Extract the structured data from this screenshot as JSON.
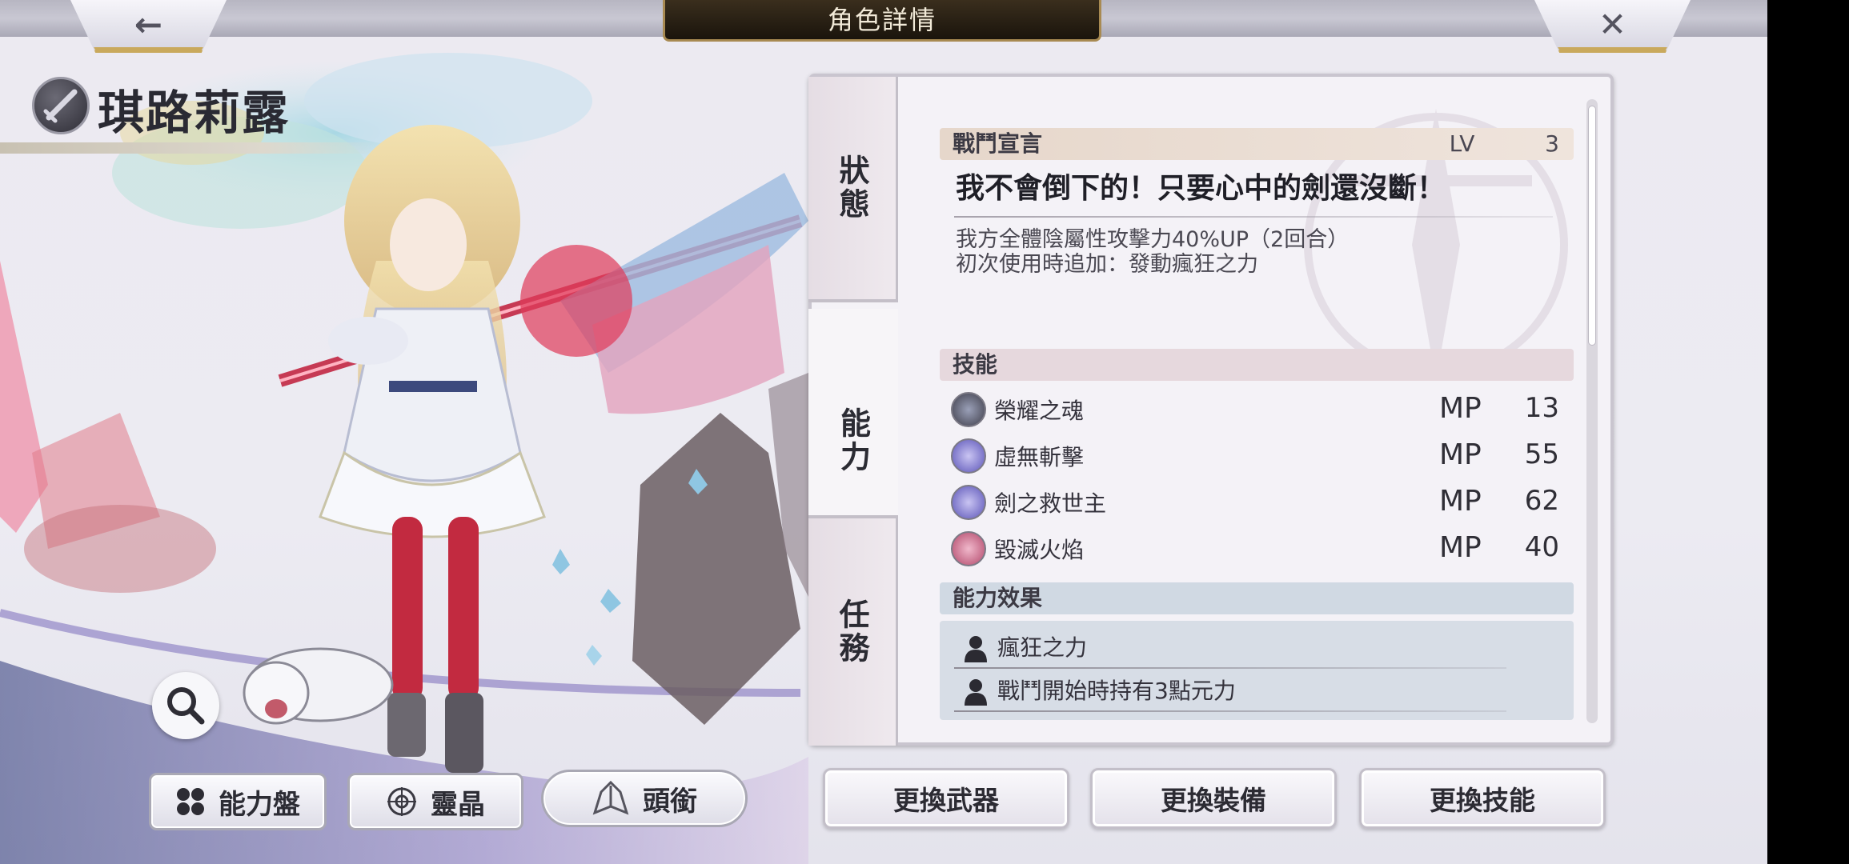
{
  "header": {
    "title": "角色詳情",
    "back_icon": "←",
    "close_icon": "✕"
  },
  "character": {
    "name": "琪路莉露",
    "class_icon": "sword-icon"
  },
  "left_buttons": {
    "ability_board": "能力盤",
    "crystal": "靈晶",
    "title": "頭銜"
  },
  "tabs": {
    "status": "狀態",
    "ability": "能力",
    "mission": "任務"
  },
  "battle_declaration": {
    "header": "戰鬥宣言",
    "lv_label": "LV",
    "lv_value": "3",
    "quote": "我不會倒下的！只要心中的劍還沒斷！",
    "desc_line1": "我方全體陰屬性攻擊力40%UP（2回合）",
    "desc_line2": "初次使用時追加：發動瘋狂之力"
  },
  "skills": {
    "header": "技能",
    "items": [
      {
        "name": "榮耀之魂",
        "mp_label": "MP",
        "mp": "13",
        "icon_color": "#3f3e4a"
      },
      {
        "name": "虛無斬擊",
        "mp_label": "MP",
        "mp": "55",
        "icon_color": "#5b54b8"
      },
      {
        "name": "劍之救世主",
        "mp_label": "MP",
        "mp": "62",
        "icon_color": "#5b54b8"
      },
      {
        "name": "毀滅火焰",
        "mp_label": "MP",
        "mp": "40",
        "icon_color": "#b2476a"
      }
    ]
  },
  "ability_effects": {
    "header": "能力效果",
    "items": [
      {
        "text": "瘋狂之力"
      },
      {
        "text": "戰鬥開始時持有3點元力"
      }
    ]
  },
  "action_buttons": {
    "change_weapon": "更換武器",
    "change_equipment": "更換裝備",
    "change_skill": "更換技能"
  }
}
